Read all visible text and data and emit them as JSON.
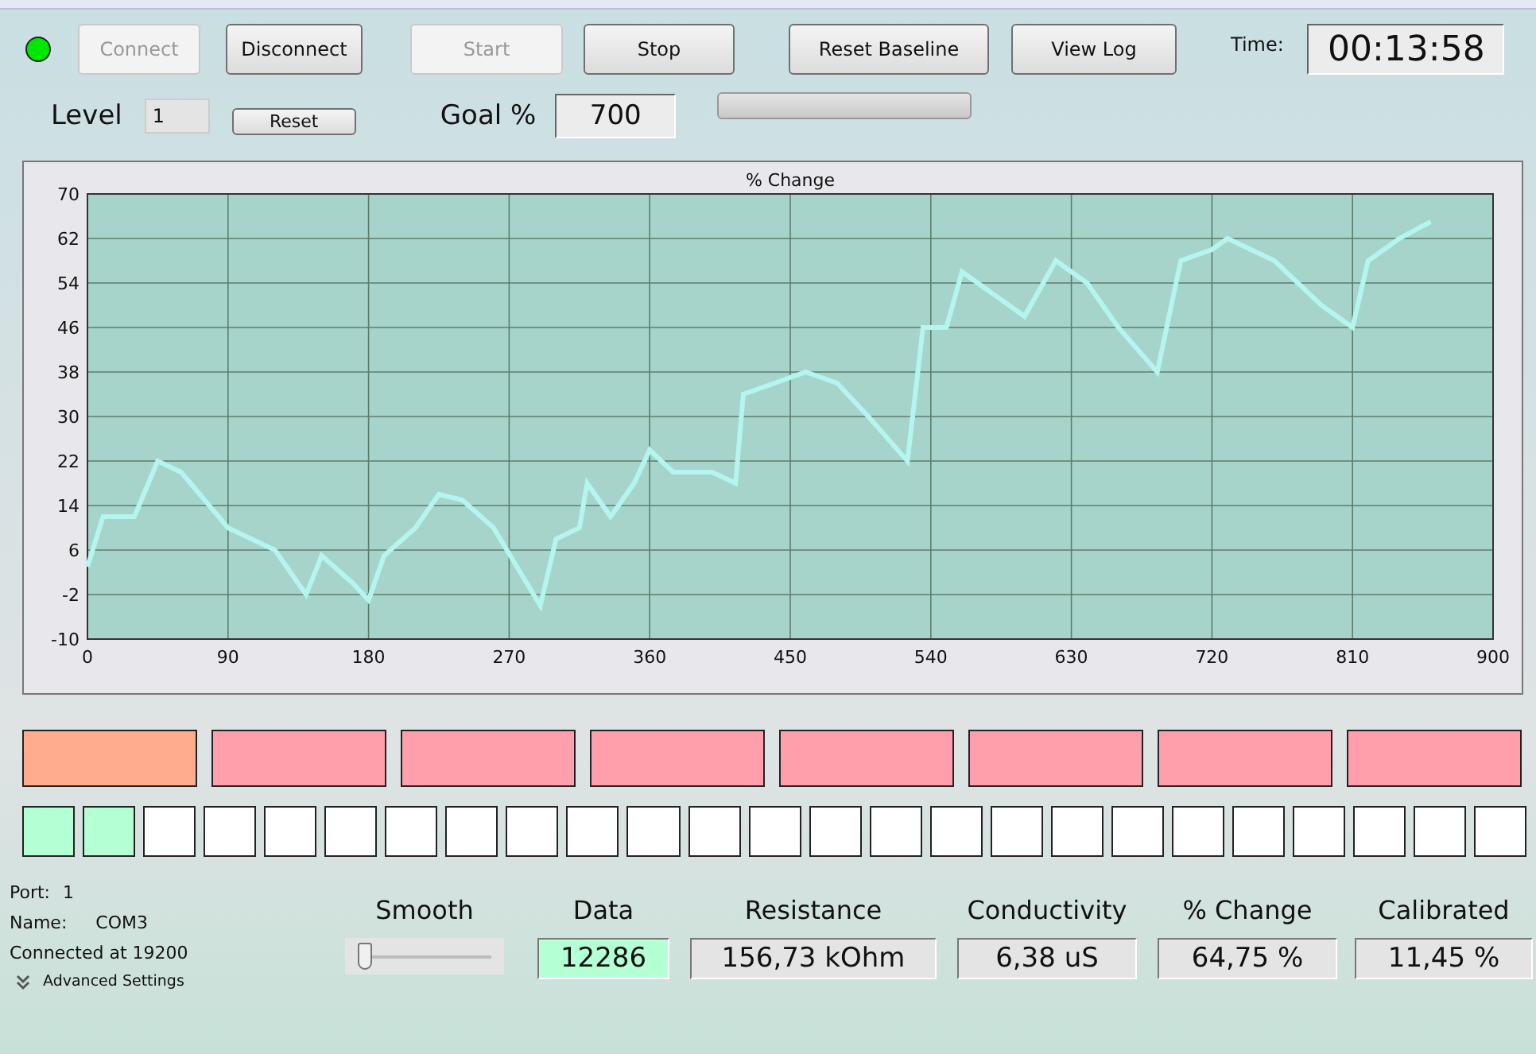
{
  "toolbar": {
    "status_led": {
      "on": true
    },
    "buttons": [
      {
        "label": "Connect",
        "disabled": true
      },
      {
        "label": "Disconnect",
        "disabled": false
      },
      {
        "label": "Start",
        "disabled": true
      },
      {
        "label": "Stop",
        "disabled": false
      },
      {
        "label": "Reset Baseline",
        "disabled": false
      },
      {
        "label": "View Log",
        "disabled": false
      }
    ],
    "time_label": "Time:",
    "time_value": "00:13:58"
  },
  "level_row": {
    "level_label": "Level",
    "level_value": "1",
    "reset_button": "Reset",
    "goal_label": "Goal %",
    "goal_value": "700",
    "progress": {
      "level": 0
    }
  },
  "chart": {
    "chart_data": {
      "type": "line",
      "title": "% Change",
      "grid": true,
      "xlim": [
        0,
        900
      ],
      "ylim": [
        -10,
        70
      ],
      "xticks": [
        0,
        90,
        180,
        270,
        360,
        450,
        540,
        630,
        720,
        810,
        900
      ],
      "yticks": [
        -10,
        -2,
        6,
        14,
        22,
        30,
        38,
        46,
        54,
        62,
        70
      ],
      "x": [
        0,
        10,
        30,
        45,
        60,
        90,
        120,
        140,
        150,
        170,
        180,
        190,
        210,
        225,
        240,
        260,
        290,
        300,
        315,
        320,
        335,
        350,
        360,
        375,
        400,
        415,
        420,
        440,
        460,
        480,
        500,
        525,
        535,
        550,
        560,
        580,
        600,
        620,
        640,
        660,
        685,
        700,
        720,
        730,
        760,
        790,
        810,
        820,
        840,
        860
      ],
      "series": [
        {
          "color": "#b4f5f0",
          "values": [
            3,
            12,
            12,
            22,
            20,
            10,
            6,
            -2,
            5,
            0,
            -3,
            5,
            10,
            16,
            15,
            10,
            -4,
            8,
            10,
            18,
            12,
            18,
            24,
            20,
            20,
            18,
            34,
            36,
            38,
            36,
            30,
            22,
            46,
            46,
            56,
            52,
            48,
            58,
            54,
            46,
            38,
            58,
            60,
            62,
            58,
            50,
            46,
            58,
            62,
            65
          ]
        }
      ]
    }
  },
  "indicators": {
    "blocks": [
      {
        "color": "#ffac8e"
      },
      {
        "color": "#ff9fab"
      },
      {
        "color": "#ff9fab"
      },
      {
        "color": "#ff9fab"
      },
      {
        "color": "#ff9fab"
      },
      {
        "color": "#ff9fab"
      },
      {
        "color": "#ff9fab"
      },
      {
        "color": "#ff9fab"
      }
    ],
    "cells": [
      {
        "on": true
      },
      {
        "on": true
      },
      {
        "on": false
      },
      {
        "on": false
      },
      {
        "on": false
      },
      {
        "on": false
      },
      {
        "on": false
      },
      {
        "on": false
      },
      {
        "on": false
      },
      {
        "on": false
      },
      {
        "on": false
      },
      {
        "on": false
      },
      {
        "on": false
      },
      {
        "on": false
      },
      {
        "on": false
      },
      {
        "on": false
      },
      {
        "on": false
      },
      {
        "on": false
      },
      {
        "on": false
      },
      {
        "on": false
      },
      {
        "on": false
      },
      {
        "on": false
      },
      {
        "on": false
      },
      {
        "on": false
      },
      {
        "on": false
      }
    ]
  },
  "port_info": {
    "port_label": "Port:",
    "port_value": "1",
    "name_label": "Name:",
    "name_value": "COM3",
    "connected": "Connected at 19200",
    "advanced": "Advanced Settings"
  },
  "smooth": {
    "label": "Smooth",
    "level": 0.05
  },
  "readouts": [
    {
      "label": "Data",
      "value": "12286",
      "highlighted": true
    },
    {
      "label": "Resistance",
      "value": "156,73 kOhm",
      "highlighted": false
    },
    {
      "label": "Conductivity",
      "value": "6,38 uS",
      "highlighted": false
    },
    {
      "label": "% Change",
      "value": "64,75 %",
      "highlighted": false
    },
    {
      "label": "Calibrated",
      "value": "11,45 %",
      "highlighted": false
    }
  ]
}
